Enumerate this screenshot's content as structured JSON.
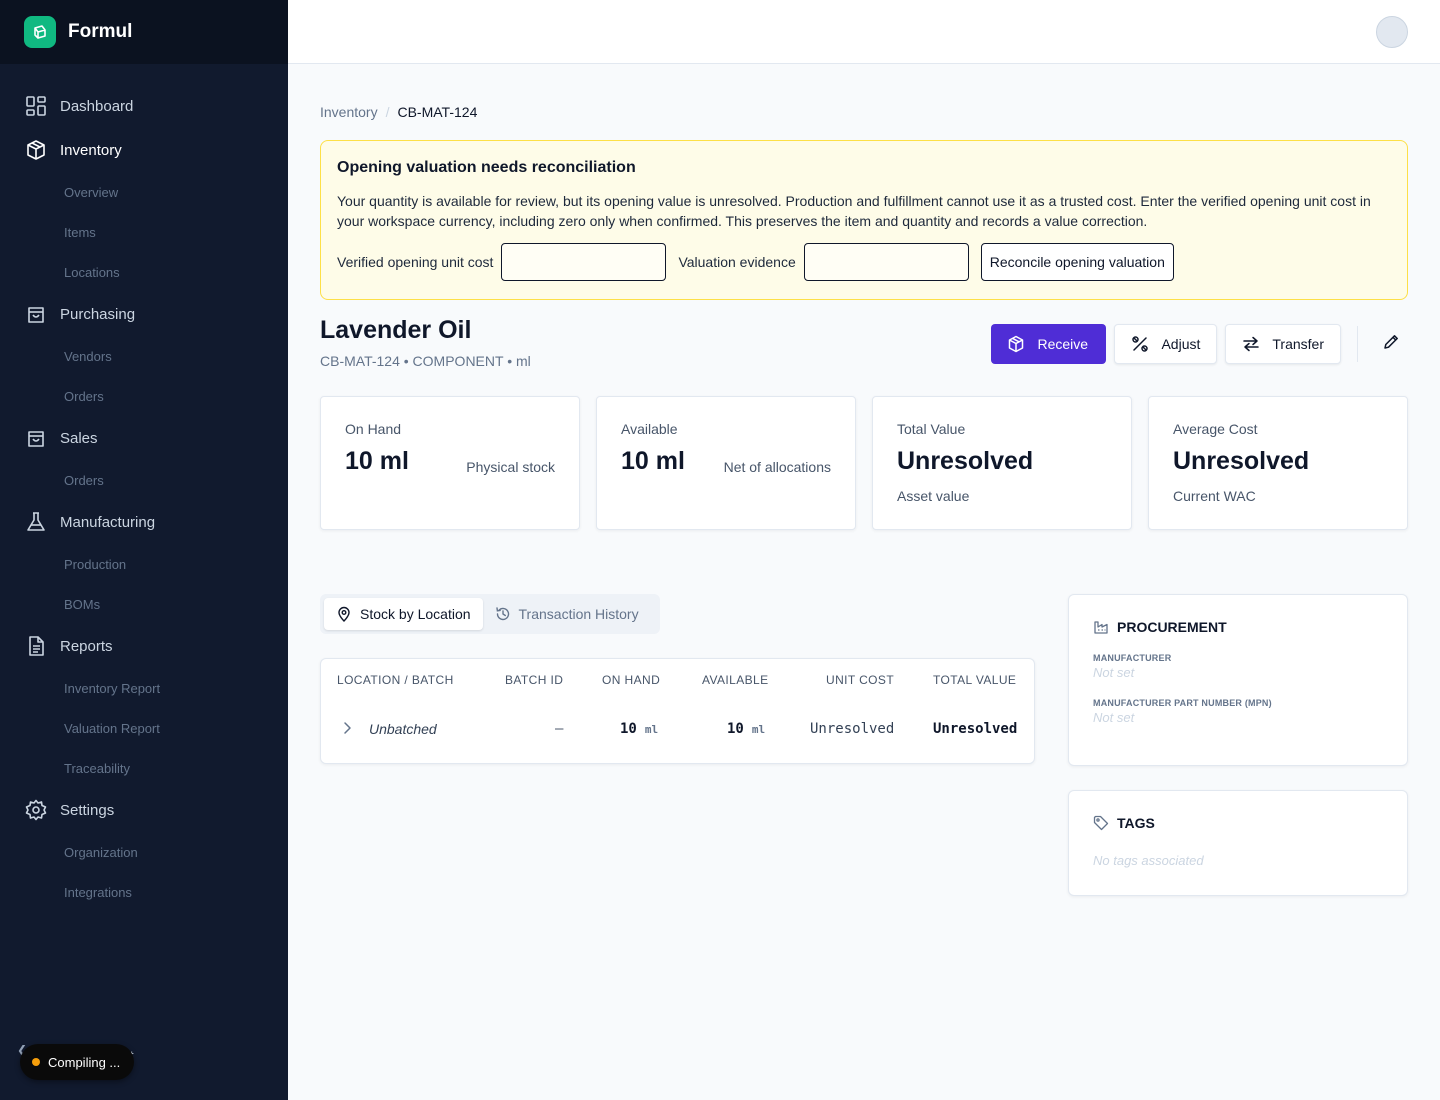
{
  "app": {
    "name": "Formul"
  },
  "sidebar": {
    "groups": [
      {
        "label": "Dashboard",
        "icon": "grid-icon",
        "subs": []
      },
      {
        "label": "Inventory",
        "icon": "box-icon",
        "subs": [
          "Overview",
          "Items",
          "Locations"
        ]
      },
      {
        "label": "Purchasing",
        "icon": "bag-icon",
        "subs": [
          "Vendors",
          "Orders"
        ]
      },
      {
        "label": "Sales",
        "icon": "bag-icon",
        "subs": [
          "Orders"
        ]
      },
      {
        "label": "Manufacturing",
        "icon": "flask-icon",
        "subs": [
          "Production",
          "BOMs"
        ]
      },
      {
        "label": "Reports",
        "icon": "document-icon",
        "subs": [
          "Inventory Report",
          "Valuation Report",
          "Traceability"
        ]
      },
      {
        "label": "Settings",
        "icon": "gear-icon",
        "subs": [
          "Organization",
          "Integrations"
        ]
      }
    ],
    "active": "Inventory",
    "footer_partial_text": "t"
  },
  "status_toast": {
    "label": "Compiling ...",
    "dot_color": "#f59e0b"
  },
  "breadcrumb": {
    "parent": "Inventory",
    "separator": "/",
    "current": "CB-MAT-124"
  },
  "alert": {
    "title": "Opening valuation needs reconciliation",
    "body": "Your quantity is available for review, but its opening value is unresolved. Production and fulfillment cannot use it as a trusted cost. Enter the verified opening unit cost in your workspace currency, including zero only when confirmed. This preserves the item and quantity and records a value correction.",
    "cost_label": "Verified opening unit cost",
    "cost_value": "",
    "evidence_label": "Valuation evidence",
    "evidence_value": "",
    "button": "Reconcile opening valuation"
  },
  "item": {
    "name": "Lavender Oil",
    "meta": "CB-MAT-124 • COMPONENT • ml"
  },
  "actions": {
    "receive": "Receive",
    "adjust": "Adjust",
    "transfer": "Transfer"
  },
  "stats": [
    {
      "label": "On Hand",
      "value": "10 ml",
      "sub": "Physical stock",
      "layout": "inline"
    },
    {
      "label": "Available",
      "value": "10 ml",
      "sub": "Net of allocations",
      "layout": "inline"
    },
    {
      "label": "Total Value",
      "value": "Unresolved",
      "sub": "Asset value",
      "layout": "block"
    },
    {
      "label": "Average Cost",
      "value": "Unresolved",
      "sub": "Current WAC",
      "layout": "block"
    }
  ],
  "tabs": [
    {
      "label": "Stock by Location",
      "active": true
    },
    {
      "label": "Transaction History",
      "active": false
    }
  ],
  "table": {
    "headers": [
      "LOCATION / BATCH",
      "BATCH ID",
      "ON HAND",
      "AVAILABLE",
      "UNIT COST",
      "TOTAL VALUE"
    ],
    "rows": [
      {
        "location": "Unbatched",
        "batch_id": "—",
        "on_hand": "10",
        "on_hand_unit": "ml",
        "available": "10",
        "available_unit": "ml",
        "unit_cost": "Unresolved",
        "total_value": "Unresolved"
      }
    ]
  },
  "procurement": {
    "title": "PROCUREMENT",
    "manufacturer_label": "MANUFACTURER",
    "manufacturer_value": "Not set",
    "mpn_label": "MANUFACTURER PART NUMBER (MPN)",
    "mpn_value": "Not set"
  },
  "tags": {
    "title": "TAGS",
    "empty": "No tags associated"
  },
  "colors": {
    "sidebar": "#111a2e",
    "accent": "#4f2dd6",
    "brand": "#10b981",
    "alert_bg": "#fefce8",
    "alert_border": "#fde047"
  }
}
